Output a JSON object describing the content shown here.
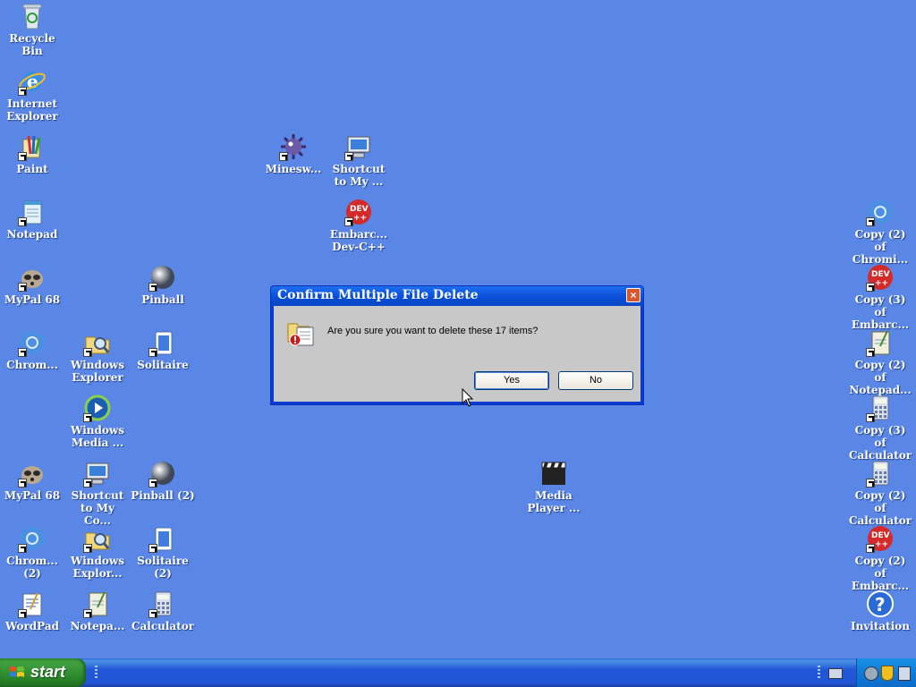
{
  "desktop_icons": [
    {
      "label": "Recycle\nBin",
      "icon": "recycle-bin-icon"
    },
    {
      "label": "Internet\nExplorer",
      "icon": "internet-explorer-icon"
    },
    {
      "label": "Paint",
      "icon": "paint-icon"
    },
    {
      "label": "Notepad",
      "icon": "notepad-icon"
    },
    {
      "label": "MyPal 68",
      "icon": "mypal-icon"
    },
    {
      "label": "Chrom...",
      "icon": "chromium-icon"
    },
    {
      "label": "MyPal 68",
      "icon": "mypal-icon"
    },
    {
      "label": "Chrom...\n(2)",
      "icon": "chromium-icon"
    },
    {
      "label": "WordPad",
      "icon": "wordpad-icon"
    },
    {
      "label": "Pinball",
      "icon": "pinball-icon"
    },
    {
      "label": "Windows\nExplorer",
      "icon": "windows-explorer-icon"
    },
    {
      "label": "Solitaire",
      "icon": "solitaire-icon"
    },
    {
      "label": "Windows\nMedia ...",
      "icon": "windows-media-icon"
    },
    {
      "label": "Shortcut\nto My Co...",
      "icon": "my-computer-icon"
    },
    {
      "label": "Pinball (2)",
      "icon": "pinball-icon"
    },
    {
      "label": "Windows\nExplor...",
      "icon": "windows-explorer-icon"
    },
    {
      "label": "Solitaire\n(2)",
      "icon": "solitaire-icon"
    },
    {
      "label": "Notepa...",
      "icon": "notepad-icon"
    },
    {
      "label": "Calculator",
      "icon": "calculator-icon"
    },
    {
      "label": "Minesw...",
      "icon": "minesweeper-icon"
    },
    {
      "label": "Shortcut\nto My ...",
      "icon": "my-computer-icon"
    },
    {
      "label": "Embarc...\nDev-C++",
      "icon": "devcpp-icon"
    },
    {
      "label": "Media\nPlayer ...",
      "icon": "media-player-icon"
    },
    {
      "label": "Copy (2) of\nChromi...",
      "icon": "chromium-icon"
    },
    {
      "label": "Copy (3) of\nEmbarc...",
      "icon": "devcpp-icon"
    },
    {
      "label": "Copy (2) of\nNotepad...",
      "icon": "notepad-icon"
    },
    {
      "label": "Copy (3) of\nCalculator",
      "icon": "calculator-icon"
    },
    {
      "label": "Copy (2) of\nCalculator",
      "icon": "calculator-icon"
    },
    {
      "label": "Copy (2) of\nEmbarc...",
      "icon": "devcpp-icon"
    },
    {
      "label": "Invitation",
      "icon": "help-icon"
    }
  ],
  "dialog": {
    "title": "Confirm Multiple File Delete",
    "message": "Are you sure you want to delete these 17 items?",
    "yes_label": "Yes",
    "no_label": "No",
    "close_glyph": "×"
  },
  "taskbar": {
    "start_label": "start"
  },
  "colors": {
    "desktop": "#5a87e5",
    "taskbar": "#2157d7",
    "start_button": "#3f9f3f"
  }
}
